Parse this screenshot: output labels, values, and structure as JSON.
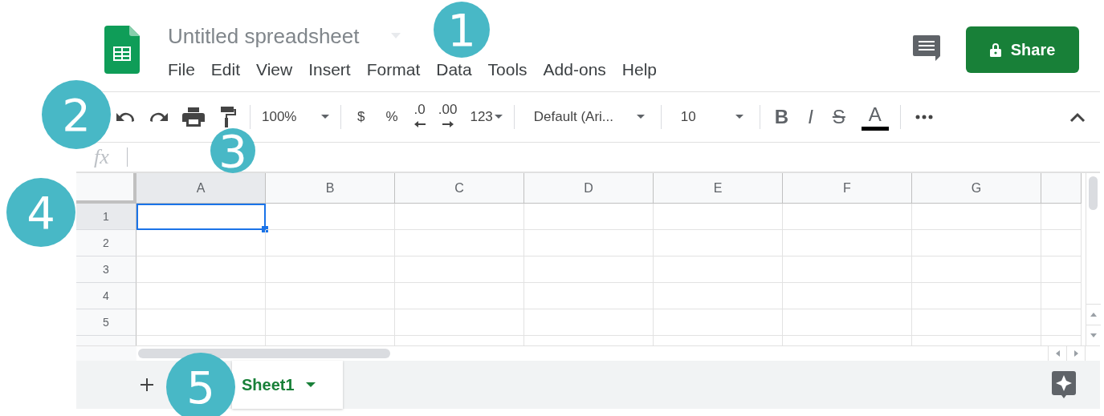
{
  "document": {
    "title": "Untitled spreadsheet"
  },
  "menu": [
    {
      "label": "File"
    },
    {
      "label": "Edit"
    },
    {
      "label": "View"
    },
    {
      "label": "Insert"
    },
    {
      "label": "Format"
    },
    {
      "label": "Data"
    },
    {
      "label": "Tools"
    },
    {
      "label": "Add-ons"
    },
    {
      "label": "Help"
    }
  ],
  "share_button": {
    "label": "Share"
  },
  "toolbar": {
    "zoom": "100%",
    "currency": "$",
    "percent": "%",
    "decrease_decimal": ".0",
    "increase_decimal": ".00",
    "number_format": "123",
    "font": "Default (Ari...",
    "font_size": "10",
    "bold": "B",
    "italic": "I",
    "strikethrough": "S",
    "text_color": {
      "label": "A",
      "color": "#000000"
    }
  },
  "formula_bar": {
    "label": "fx"
  },
  "grid": {
    "columns": [
      {
        "label": "A",
        "selected": true
      },
      {
        "label": "B",
        "selected": false
      },
      {
        "label": "C",
        "selected": false
      },
      {
        "label": "D",
        "selected": false
      },
      {
        "label": "E",
        "selected": false
      },
      {
        "label": "F",
        "selected": false
      },
      {
        "label": "G",
        "selected": false
      }
    ],
    "rows": [
      {
        "label": "1",
        "selected": true
      },
      {
        "label": "2",
        "selected": false
      },
      {
        "label": "3",
        "selected": false
      },
      {
        "label": "4",
        "selected": false
      },
      {
        "label": "5",
        "selected": false
      }
    ]
  },
  "sheet_tabs": [
    {
      "label": "Sheet1",
      "selected": true
    }
  ],
  "callouts": [
    {
      "label": "1"
    },
    {
      "label": "2"
    },
    {
      "label": "3"
    },
    {
      "label": "4"
    },
    {
      "label": "5"
    }
  ]
}
